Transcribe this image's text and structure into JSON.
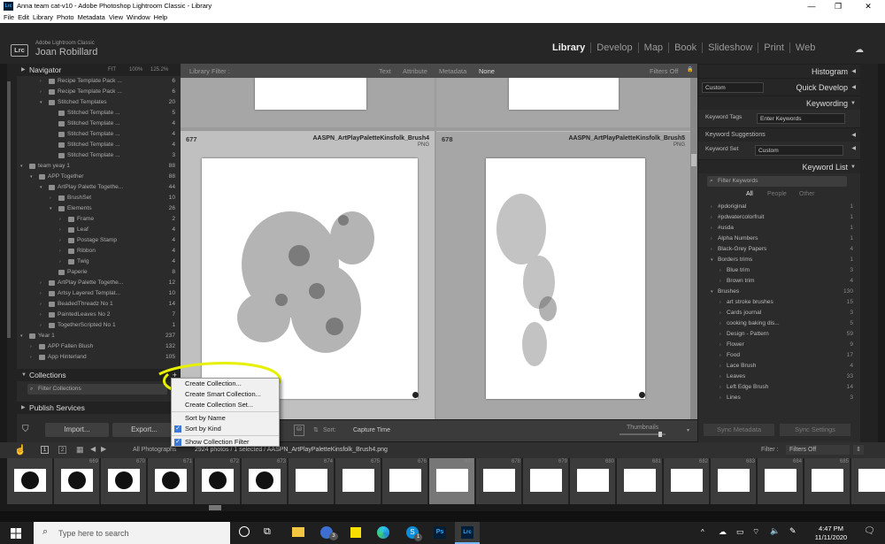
{
  "window": {
    "title": "Anna team cat-v10 - Adobe Photoshop Lightroom Classic - Library",
    "logo": "Lrc",
    "min": "—",
    "max": "❐",
    "close": "✕"
  },
  "menubar": [
    "File",
    "Edit",
    "Library",
    "Photo",
    "Metadata",
    "View",
    "Window",
    "Help"
  ],
  "identity": {
    "logo": "Lrc",
    "brand": "Adobe Lightroom Classic",
    "user": "Joan Robillard"
  },
  "modules": [
    "Library",
    "Develop",
    "Map",
    "Book",
    "Slideshow",
    "Print",
    "Web"
  ],
  "navigator": {
    "label": "Navigator",
    "fit": "FIT",
    "z1": "100%",
    "z2": "125.2%"
  },
  "folders": [
    {
      "name": "Recipe Template Pack ...",
      "count": "6",
      "indent": 3,
      "arrow": "›"
    },
    {
      "name": "Recipe Template Pack ...",
      "count": "6",
      "indent": 3,
      "arrow": "›"
    },
    {
      "name": "Stitched Templates",
      "count": "20",
      "indent": 3,
      "arrow": "▾"
    },
    {
      "name": "Stitched Template ...",
      "count": "5",
      "indent": 4,
      "arrow": ""
    },
    {
      "name": "Stitched Template ...",
      "count": "4",
      "indent": 4,
      "arrow": ""
    },
    {
      "name": "Stitched Template ...",
      "count": "4",
      "indent": 4,
      "arrow": ""
    },
    {
      "name": "Stitched Template ...",
      "count": "4",
      "indent": 4,
      "arrow": ""
    },
    {
      "name": "Stitched Template ...",
      "count": "3",
      "indent": 4,
      "arrow": ""
    },
    {
      "name": "team yeay 1",
      "count": "88",
      "indent": 1,
      "arrow": "▾"
    },
    {
      "name": "APP Together",
      "count": "88",
      "indent": 2,
      "arrow": "▾"
    },
    {
      "name": "ArtPlay Palette Togethe...",
      "count": "44",
      "indent": 3,
      "arrow": "▾"
    },
    {
      "name": "BrushSet",
      "count": "10",
      "indent": 4,
      "arrow": "›"
    },
    {
      "name": "Elements",
      "count": "26",
      "indent": 4,
      "arrow": "▾"
    },
    {
      "name": "Frame",
      "count": "2",
      "indent": 5,
      "arrow": "›"
    },
    {
      "name": "Leaf",
      "count": "4",
      "indent": 5,
      "arrow": "›"
    },
    {
      "name": "Postage Stamp",
      "count": "4",
      "indent": 5,
      "arrow": "›"
    },
    {
      "name": "Ribbon",
      "count": "4",
      "indent": 5,
      "arrow": "›"
    },
    {
      "name": "Twig",
      "count": "4",
      "indent": 5,
      "arrow": "›"
    },
    {
      "name": "Paperie",
      "count": "8",
      "indent": 4,
      "arrow": ""
    },
    {
      "name": "ArtPlay Palette Togethe...",
      "count": "12",
      "indent": 3,
      "arrow": "›"
    },
    {
      "name": "Artsy Layered Templat...",
      "count": "10",
      "indent": 3,
      "arrow": "›"
    },
    {
      "name": "BeadedThreadz No 1",
      "count": "14",
      "indent": 3,
      "arrow": "›"
    },
    {
      "name": "PaintedLeaves No 2",
      "count": "7",
      "indent": 3,
      "arrow": "›"
    },
    {
      "name": "TogetherScripted No 1",
      "count": "1",
      "indent": 3,
      "arrow": "›"
    },
    {
      "name": "Year 1",
      "count": "237",
      "indent": 1,
      "arrow": "▾"
    },
    {
      "name": "APP Fallen Blush",
      "count": "132",
      "indent": 2,
      "arrow": "›"
    },
    {
      "name": "App Hinterland",
      "count": "105",
      "indent": 2,
      "arrow": "›"
    }
  ],
  "collections": {
    "label": "Collections",
    "add": "+",
    "filter_label": "Filter Collections"
  },
  "publish": {
    "label": "Publish Services",
    "add": "+"
  },
  "left_buttons": {
    "import": "Import...",
    "export": "Export..."
  },
  "library_filter": {
    "label": "Library Filter :",
    "tabs": [
      "Text",
      "Attribute",
      "Metadata",
      "None"
    ],
    "filters_off": "Filters Off"
  },
  "cells": [
    {
      "num": "677",
      "name": "AASPN_ArtPlayPaletteKinsfolk_Brush4",
      "type": "PNG"
    },
    {
      "num": "678",
      "name": "AASPN_ArtPlayPaletteKinsfolk_Brush5",
      "type": "PNG"
    }
  ],
  "toolbar": {
    "sort_label": "Sort:",
    "sort_value": "Capture Time",
    "thumbnails": "Thumbnails"
  },
  "right": {
    "histogram": "Histogram",
    "quick_develop": "Quick Develop",
    "quick_preset": "Custom",
    "keywording": "Keywording",
    "keyword_tags_label": "Keyword Tags",
    "keyword_tags_value": "Enter Keywords",
    "keyword_suggestions": "Keyword Suggestions",
    "keyword_set_label": "Keyword Set",
    "keyword_set_value": "Custom",
    "keyword_list": "Keyword List",
    "filter_keywords": "Filter Keywords",
    "tabs": [
      "All",
      "People",
      "Other"
    ],
    "keywords": [
      {
        "name": "#pdoriginal",
        "count": "1",
        "indent": 1,
        "arrow": "›"
      },
      {
        "name": "#pdwatercolorfruit",
        "count": "1",
        "indent": 1,
        "arrow": "›"
      },
      {
        "name": "#usda",
        "count": "1",
        "indent": 1,
        "arrow": "›"
      },
      {
        "name": "Alpha Numbers",
        "count": "1",
        "indent": 1,
        "arrow": "›"
      },
      {
        "name": "Black-Grey Papers",
        "count": "4",
        "indent": 1,
        "arrow": "›"
      },
      {
        "name": "Borders trims",
        "count": "1",
        "indent": 1,
        "arrow": "▾"
      },
      {
        "name": "Blue trim",
        "count": "3",
        "indent": 2,
        "arrow": "›"
      },
      {
        "name": "Brown trim",
        "count": "4",
        "indent": 2,
        "arrow": "›"
      },
      {
        "name": "Brushes",
        "count": "130",
        "indent": 1,
        "arrow": "▾"
      },
      {
        "name": "art stroke brushes",
        "count": "15",
        "indent": 2,
        "arrow": "›"
      },
      {
        "name": "Cards journal",
        "count": "3",
        "indent": 2,
        "arrow": "›"
      },
      {
        "name": "cooking baking dis...",
        "count": "5",
        "indent": 2,
        "arrow": "›"
      },
      {
        "name": "Design - Pattern",
        "count": "59",
        "indent": 2,
        "arrow": "›"
      },
      {
        "name": "Flower",
        "count": "9",
        "indent": 2,
        "arrow": "›"
      },
      {
        "name": "Food",
        "count": "17",
        "indent": 2,
        "arrow": "›"
      },
      {
        "name": "Lace Brush",
        "count": "4",
        "indent": 2,
        "arrow": "›"
      },
      {
        "name": "Leaves",
        "count": "33",
        "indent": 2,
        "arrow": "›"
      },
      {
        "name": "Left Edge Brush",
        "count": "14",
        "indent": 2,
        "arrow": "›"
      },
      {
        "name": "Lines",
        "count": "3",
        "indent": 2,
        "arrow": "›"
      }
    ],
    "sync_metadata": "Sync Metadata",
    "sync_settings": "Sync Settings"
  },
  "filmstrip": {
    "source": "All Photographs",
    "info": "2924 photos / 1 selected / AASPN_ArtPlayPaletteKinsfolk_Brush4.png",
    "filter_label": "Filter :",
    "filter_value": "Filters Off",
    "nums": [
      "",
      "669",
      "670",
      "671",
      "672",
      "673",
      "674",
      "675",
      "676",
      "677",
      "678",
      "679",
      "680",
      "681",
      "682",
      "683",
      "684",
      "685",
      "686"
    ]
  },
  "context_menu": [
    {
      "label": "Create Collection...",
      "checked": false
    },
    {
      "label": "Create Smart Collection...",
      "checked": false
    },
    {
      "label": "Create Collection Set...",
      "checked": false
    },
    {
      "sep": true
    },
    {
      "label": "Sort by Name",
      "checked": false
    },
    {
      "label": "Sort by Kind",
      "checked": true
    },
    {
      "sep": true
    },
    {
      "label": "Show Collection Filter",
      "checked": true
    }
  ],
  "taskbar": {
    "search_placeholder": "Type here to search",
    "time": "4:47 PM",
    "date": "11/11/2020",
    "ps": "Ps",
    "lrc": "Lrc",
    "badge1": "3",
    "badge2": "1"
  },
  "colors": {
    "highlight": "#e6f000",
    "accent": "#3b78d8"
  }
}
